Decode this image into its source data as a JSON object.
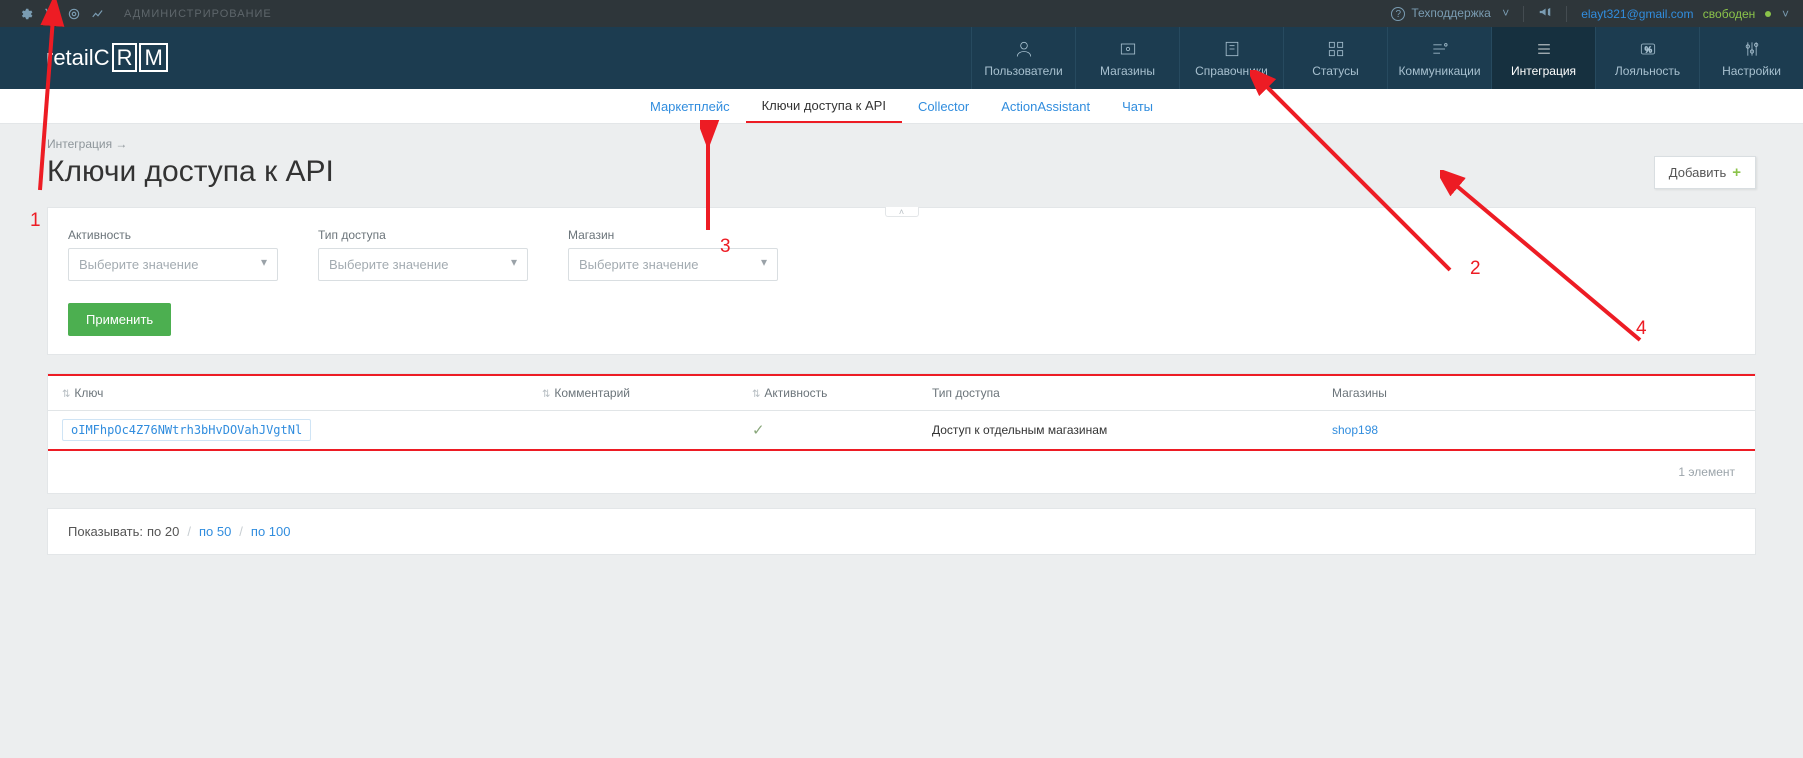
{
  "topbar": {
    "admin_label": "АДМИНИСТРИРОВАНИЕ",
    "support_label": "Техподдержка",
    "user_email": "elayt321@gmail.com",
    "user_status": "свободен"
  },
  "logo": {
    "text_a": "retail",
    "text_b": "C",
    "text_c": "R",
    "text_d": "M"
  },
  "nav": [
    {
      "label": "Пользователи"
    },
    {
      "label": "Магазины"
    },
    {
      "label": "Справочники"
    },
    {
      "label": "Статусы"
    },
    {
      "label": "Коммуникации"
    },
    {
      "label": "Интеграция"
    },
    {
      "label": "Лояльность"
    },
    {
      "label": "Настройки"
    }
  ],
  "subnav": [
    {
      "label": "Маркетплейс"
    },
    {
      "label": "Ключи доступа к API"
    },
    {
      "label": "Collector"
    },
    {
      "label": "ActionAssistant"
    },
    {
      "label": "Чаты"
    }
  ],
  "breadcrumb": "Интеграция →",
  "page_title": "Ключи доступа к API",
  "add_button": "Добавить",
  "filters": {
    "activity_label": "Активность",
    "access_label": "Тип доступа",
    "shop_label": "Магазин",
    "placeholder": "Выберите значение",
    "apply": "Применить"
  },
  "table": {
    "head": {
      "key": "Ключ",
      "comment": "Комментарий",
      "active": "Активность",
      "access": "Тип доступа",
      "shops": "Магазины"
    },
    "row": {
      "key": "oIMFhpOc4Z76NWtrh3bHvDOVahJVgtNl",
      "access": "Доступ к отдельным магазинам",
      "shop": "shop198"
    },
    "footer": "1 элемент"
  },
  "pager": {
    "label": "Показывать:",
    "p20": "по 20",
    "p50": "по 50",
    "p100": "по 100"
  },
  "anno": {
    "n1": "1",
    "n2": "2",
    "n3": "3",
    "n4": "4"
  }
}
